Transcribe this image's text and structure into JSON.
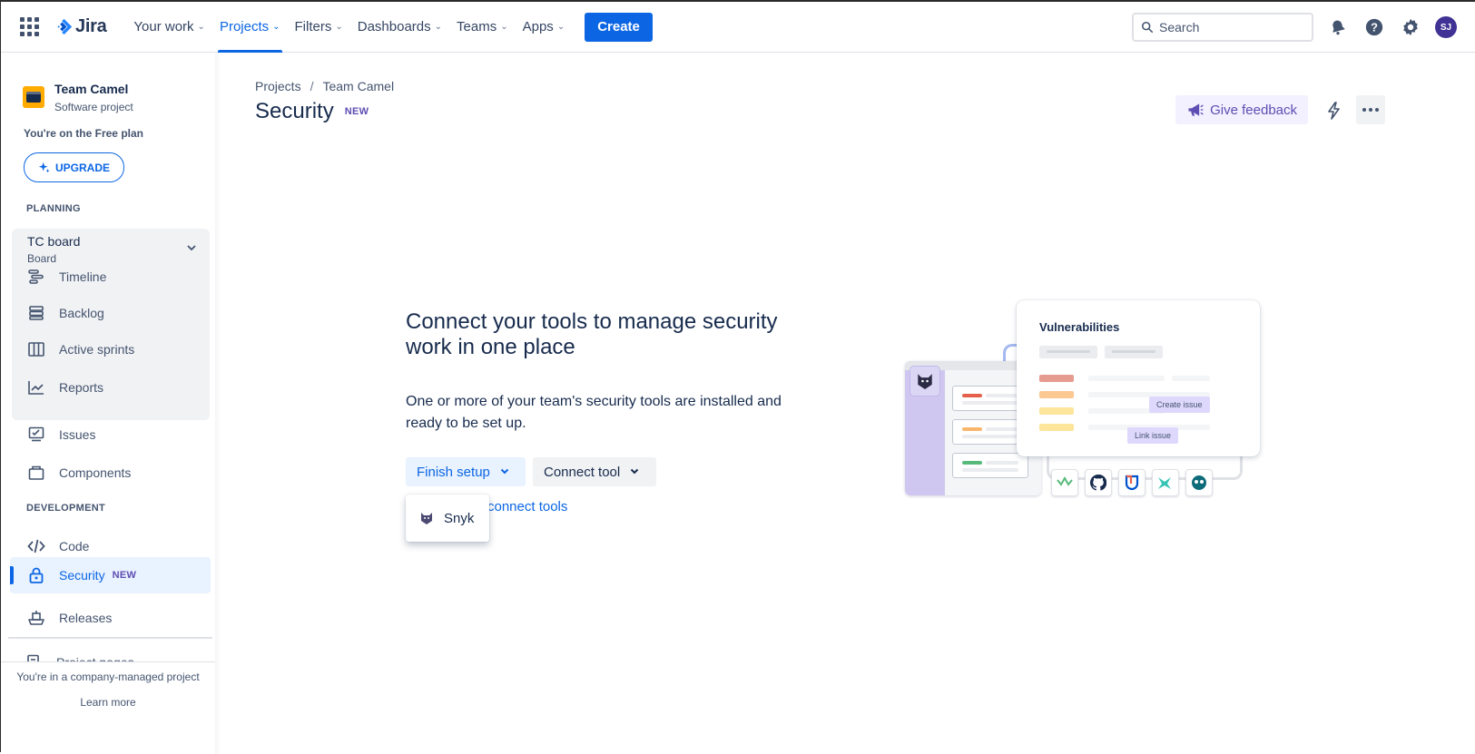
{
  "topnav": {
    "logo_text": "Jira",
    "links": [
      {
        "label": "Your work"
      },
      {
        "label": "Projects"
      },
      {
        "label": "Filters"
      },
      {
        "label": "Dashboards"
      },
      {
        "label": "Teams"
      },
      {
        "label": "Apps"
      }
    ],
    "create_label": "Create",
    "search_placeholder": "Search",
    "avatar_initials": "SJ"
  },
  "sidebar": {
    "project_name": "Team Camel",
    "project_type": "Software project",
    "plan_text": "You're on the Free plan",
    "upgrade_label": "UPGRADE",
    "planning_header": "PLANNING",
    "board_title": "TC board",
    "board_subtitle": "Board",
    "planning_items": [
      {
        "label": "Timeline",
        "icon": "timeline-icon"
      },
      {
        "label": "Backlog",
        "icon": "backlog-icon"
      },
      {
        "label": "Active sprints",
        "icon": "active-sprints-icon"
      },
      {
        "label": "Reports",
        "icon": "reports-icon"
      }
    ],
    "other_items": [
      {
        "label": "Issues",
        "icon": "issues-icon"
      },
      {
        "label": "Components",
        "icon": "components-icon"
      }
    ],
    "development_header": "DEVELOPMENT",
    "development_items": [
      {
        "label": "Code",
        "icon": "code-icon"
      },
      {
        "label": "Security",
        "icon": "lock-icon",
        "badge": "NEW",
        "active": true
      },
      {
        "label": "Releases",
        "icon": "releases-icon"
      }
    ],
    "project_pages_label": "Project pages",
    "footer_text": "You're in a company-managed project",
    "footer_link": "Learn more"
  },
  "main": {
    "breadcrumb": [
      "Projects",
      "Team Camel"
    ],
    "title": "Security",
    "title_badge": "NEW",
    "feedback_label": "Give feedback",
    "hero_heading": "Connect your tools to manage security work in one place",
    "hero_body": "One or more of your team's security tools are installed and ready to be set up.",
    "finish_setup_label": "Finish setup",
    "connect_tool_label": "Connect tool",
    "connect_tools_link": "connect tools",
    "dropdown_option": "Snyk",
    "illustration": {
      "card_title": "Vulnerabilities",
      "create_issue_label": "Create issue",
      "link_issue_label": "Link issue"
    }
  },
  "colors": {
    "accent": "#0c66e4",
    "discovery_purple": "#5e4db2",
    "text": "#172b4d"
  }
}
